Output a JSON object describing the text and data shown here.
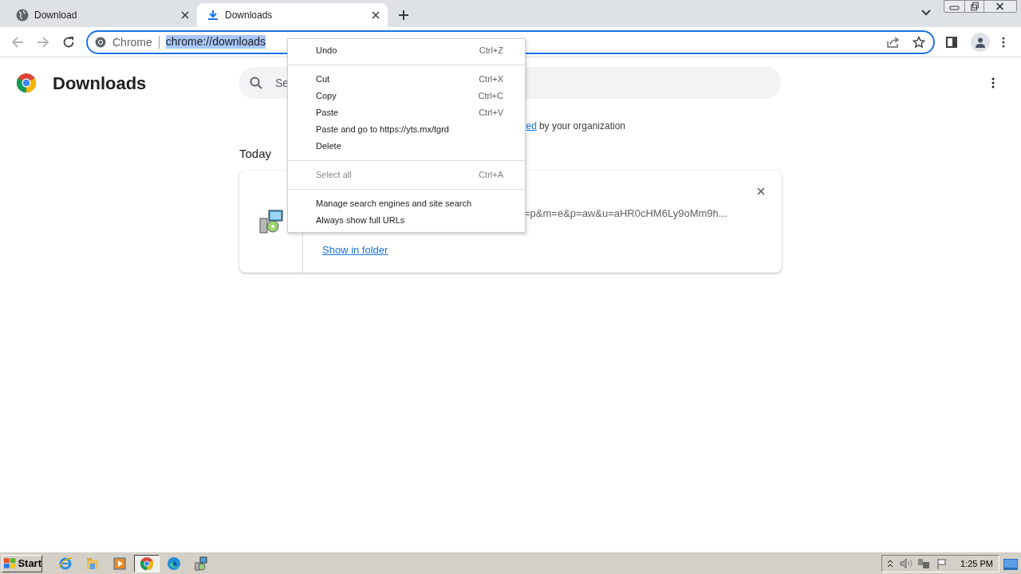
{
  "tabs": [
    {
      "title": "Download",
      "selected": false
    },
    {
      "title": "Downloads",
      "selected": true
    }
  ],
  "omnibox": {
    "chip": "Chrome",
    "url": "chrome://downloads",
    "text_selected": true
  },
  "page": {
    "title": "Downloads",
    "search_placeholder": "Se",
    "banner": {
      "link": "ed",
      "text": "by your organization"
    },
    "section": "Today",
    "download": {
      "url": "=p&m=e&p=aw&u=aHR0cHM6Ly9oMm9h...",
      "action": "Show in folder"
    }
  },
  "context_menu": [
    [
      {
        "label": "Undo",
        "shortcut": "Ctrl+Z",
        "disabled": false
      }
    ],
    [
      {
        "label": "Cut",
        "shortcut": "Ctrl+X",
        "disabled": false
      },
      {
        "label": "Copy",
        "shortcut": "Ctrl+C",
        "disabled": false
      },
      {
        "label": "Paste",
        "shortcut": "Ctrl+V",
        "disabled": false
      },
      {
        "label": "Paste and go to https://yts.mx/tgrd",
        "disabled": false
      },
      {
        "label": "Delete",
        "disabled": false
      }
    ],
    [
      {
        "label": "Select all",
        "shortcut": "Ctrl+A",
        "disabled": true
      }
    ],
    [
      {
        "label": "Manage search engines and site search",
        "disabled": false
      },
      {
        "label": "Always show full URLs",
        "disabled": false
      }
    ]
  ],
  "taskbar": {
    "start": "Start",
    "apps": [
      {
        "selected": false
      },
      {
        "selected": false
      },
      {
        "selected": false
      },
      {
        "selected": true
      },
      {
        "selected": false
      },
      {
        "selected": false
      }
    ],
    "clock": "1:25 PM"
  }
}
